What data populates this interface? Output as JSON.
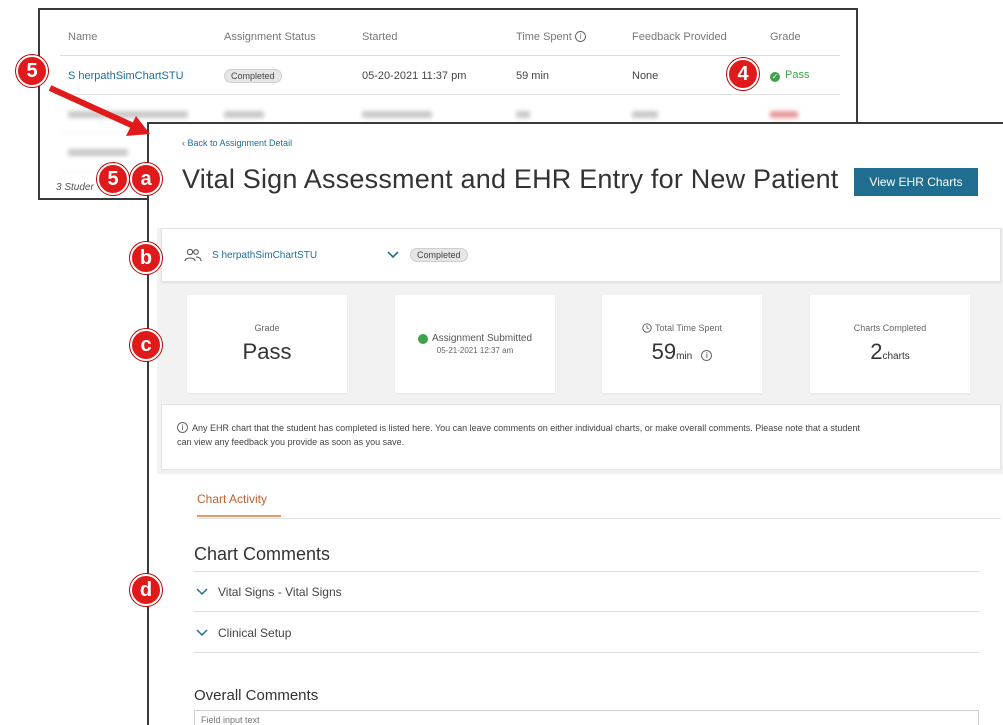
{
  "list": {
    "columns": {
      "name": "Name",
      "status": "Assignment Status",
      "started": "Started",
      "time_spent": "Time Spent",
      "feedback": "Feedback Provided",
      "grade": "Grade"
    },
    "row": {
      "name": "S herpathSimChartSTU",
      "status": "Completed",
      "started": "05-20-2021 11:37 pm",
      "time_spent": "59 min",
      "feedback": "None",
      "grade": "Pass"
    },
    "footer": "3 Studer"
  },
  "detail": {
    "back_link": "Back to Assignment Detail",
    "title": "Vital Sign Assessment and EHR Entry for New Patient",
    "view_charts_button": "View EHR Charts",
    "student": {
      "name": "S herpathSimChartSTU",
      "status": "Completed"
    },
    "cards": {
      "grade_label": "Grade",
      "grade_value": "Pass",
      "submitted_label": "Assignment Submitted",
      "submitted_date": "05-21-2021 12:37 am",
      "time_label": "Total Time Spent",
      "time_value": "59",
      "time_unit": "min",
      "charts_label": "Charts Completed",
      "charts_value": "2",
      "charts_unit": "charts"
    },
    "notice_line1": "Any EHR chart that the student has completed is listed here. You can leave comments on either individual charts, or make overall comments. Please note that a student",
    "notice_line2": "can view any feedback you provide as soon as you save.",
    "tab": "Chart Activity",
    "chart_comments_title": "Chart Comments",
    "chart_comment_items": [
      "Vital Signs - Vital Signs",
      "Clinical Setup"
    ],
    "overall_comments_title": "Overall Comments",
    "overall_placeholder": "Field input text"
  },
  "callouts": {
    "row_marker": "5",
    "grade_marker": "4",
    "title_marker_num": "5",
    "title_marker_letter": "a",
    "student_marker": "b",
    "cards_marker": "c",
    "comments_marker": "d"
  },
  "colors": {
    "accent": "#1f6e8f",
    "link": "#1f6e9c",
    "pass": "#3fa34d",
    "tab_active": "#c0602f",
    "callout": "#e01a1a"
  }
}
